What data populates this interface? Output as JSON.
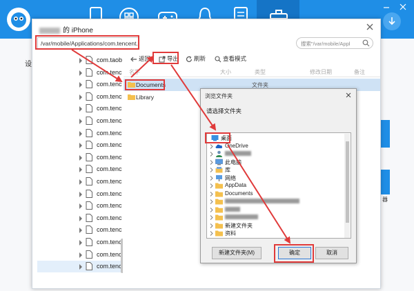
{
  "window": {
    "title_suffix": "的 iPhone"
  },
  "path_bar": {
    "value": "/var/mobile/Applications/com.tencent.xin"
  },
  "search": {
    "placeholder": "搜索\"/var/mobile/Appl"
  },
  "toolbar": {
    "back_label": "返回",
    "export_label": "导出",
    "refresh_label": "刷新",
    "view_mode_label": "查看模式"
  },
  "columns": {
    "name": "名字",
    "size": "大小",
    "type": "类型",
    "modified": "修改日期",
    "note": "备注"
  },
  "tree": {
    "items": [
      "com.taob",
      "com.tenc",
      "com.tenc",
      "com.tenc",
      "com.tenc",
      "com.tenc",
      "com.tenc",
      "com.tenc",
      "com.tenc",
      "com.tenc",
      "com.tenc",
      "com.tenc",
      "com.tenc",
      "com.tenc",
      "com.tenc",
      "com.tenc",
      "com.tenc",
      "com.tenc"
    ]
  },
  "files": [
    {
      "name": "Documents",
      "type": "文件夹"
    },
    {
      "name": "Library",
      "type": ""
    }
  ],
  "browse_dialog": {
    "title": "浏览文件夹",
    "prompt": "请选择文件夹",
    "items": [
      {
        "label": "桌面",
        "icon": "desktop-icon"
      },
      {
        "label": "OneDrive",
        "icon": "cloud-icon"
      },
      {
        "label": "",
        "icon": "user-icon"
      },
      {
        "label": "此电脑",
        "icon": "computer-icon"
      },
      {
        "label": "库",
        "icon": "library-icon"
      },
      {
        "label": "网络",
        "icon": "network-icon"
      },
      {
        "label": "AppData",
        "icon": "folder-icon"
      },
      {
        "label": "Documents",
        "icon": "folder-icon"
      },
      {
        "label": "",
        "icon": "folder-icon"
      },
      {
        "label": "",
        "icon": "folder-icon"
      },
      {
        "label": "",
        "icon": "folder-icon"
      },
      {
        "label": "新建文件夹",
        "icon": "folder-icon"
      },
      {
        "label": "资料",
        "icon": "folder-icon"
      }
    ],
    "new_folder_button": "新建文件夹(M)",
    "ok_button": "确定",
    "cancel_button": "取消"
  },
  "background": {
    "left_char": "设",
    "right_text": "器"
  },
  "colors": {
    "appbar": "#1f8ee6",
    "annotation_red": "#e03a3a",
    "selection": "#cfe2f5",
    "folder": "#f4c04e"
  }
}
